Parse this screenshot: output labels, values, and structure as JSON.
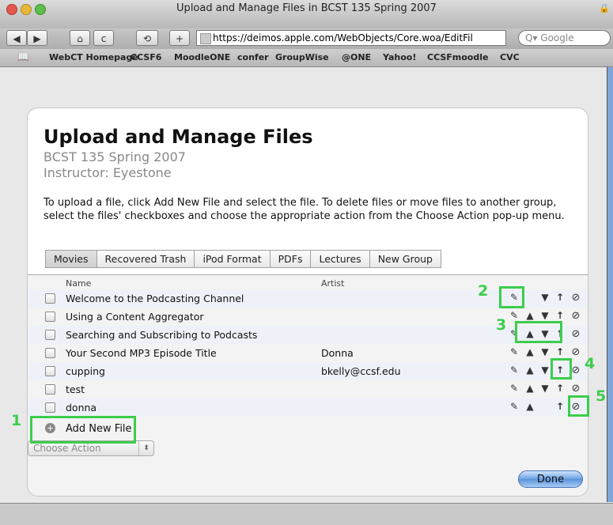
{
  "window": {
    "title": "Upload and Manage Files in BCST 135 Spring 2007"
  },
  "toolbar": {
    "back_label": "◀",
    "forward_label": "▶",
    "home_label": "⌂",
    "reload_label": "c",
    "snapback_label": "⟲",
    "add_label": "+",
    "url": "https://deimos.apple.com/WebObjects/Core.woa/EditFil",
    "search_placeholder": "Q▾ Google"
  },
  "bookmarks": [
    "WebCT Homepage",
    "CCSF6",
    "MoodleONE",
    "confer",
    "GroupWise",
    "@ONE",
    "Yahoo!",
    "CCSFmoodle",
    "CVC"
  ],
  "page": {
    "title": "Upload and Manage Files",
    "course": "BCST 135 Spring 2007",
    "instructor": "Instructor: Eyestone",
    "instructions": "To upload a file, click Add New File and select the file. To delete files or move files to another group, select the files' checkboxes and choose the appropriate action from the Choose Action pop-up menu."
  },
  "tabs": [
    "Movies",
    "Recovered Trash",
    "iPod Format",
    "PDFs",
    "Lectures",
    "New Group"
  ],
  "table": {
    "headers": {
      "name": "Name",
      "artist": "Artist"
    },
    "rows": [
      {
        "name": "Welcome to the Podcasting Channel",
        "artist": ""
      },
      {
        "name": "Using a Content Aggregator",
        "artist": ""
      },
      {
        "name": "Searching and Subscribing to Podcasts",
        "artist": ""
      },
      {
        "name": "Your Second MP3 Episode Title",
        "artist": "Donna"
      },
      {
        "name": "cupping",
        "artist": "bkelly@ccsf.edu"
      },
      {
        "name": "test",
        "artist": ""
      },
      {
        "name": "donna",
        "artist": ""
      }
    ]
  },
  "icons": {
    "edit": "✎",
    "up": "▲",
    "down": "▼",
    "top": "↑",
    "delete": "⊘",
    "add": "+"
  },
  "add_new_file": "Add New File",
  "choose_action": "Choose Action",
  "done": "Done",
  "callouts": [
    "1",
    "2",
    "3",
    "4",
    "5"
  ],
  "accent_color": "#3ccd4c"
}
